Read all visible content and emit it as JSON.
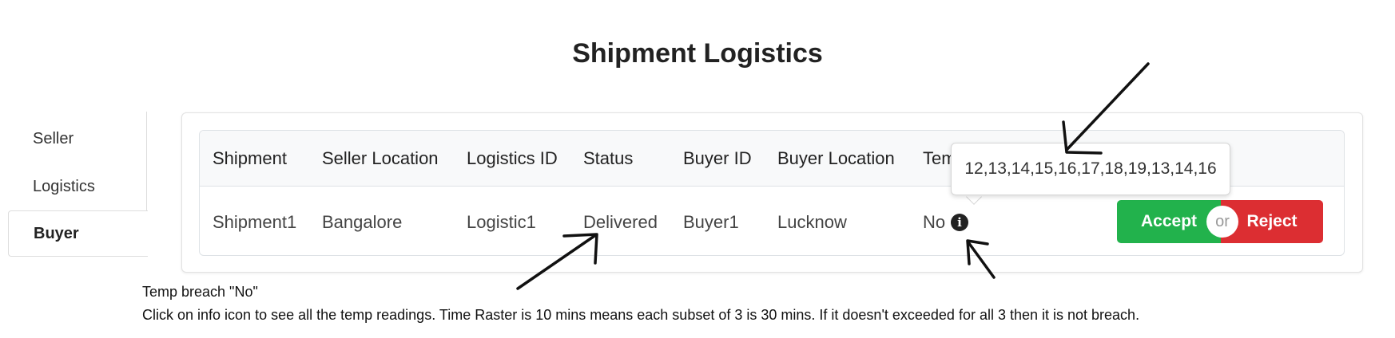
{
  "page": {
    "title": "Shipment Logistics"
  },
  "sidebar": {
    "items": [
      {
        "label": "Seller",
        "active": false
      },
      {
        "label": "Logistics",
        "active": false
      },
      {
        "label": "Buyer",
        "active": true
      }
    ]
  },
  "table": {
    "headers": [
      "Shipment",
      "Seller Location",
      "Logistics ID",
      "Status",
      "Buyer ID",
      "Buyer Location",
      "Tem"
    ],
    "row": {
      "shipment": "Shipment1",
      "seller_location": "Bangalore",
      "logistics_id": "Logistic1",
      "status": "Delivered",
      "buyer_id": "Buyer1",
      "buyer_location": "Lucknow",
      "temp_breach": "No"
    }
  },
  "actions": {
    "accept_label": "Accept",
    "or_label": "or",
    "reject_label": "Reject"
  },
  "tooltip": {
    "text": "12,13,14,15,16,17,18,19,13,14,16"
  },
  "icons": {
    "info": "info-icon"
  },
  "colors": {
    "accept": "#22b24c",
    "reject": "#dc2e32"
  },
  "annotation": {
    "line1": "Temp breach \"No\"",
    "line2": "Click on info icon to see all the temp readings. Time Raster is 10 mins means each subset of 3 is 30 mins. If it doesn't exceeded for all 3 then it is not breach."
  }
}
